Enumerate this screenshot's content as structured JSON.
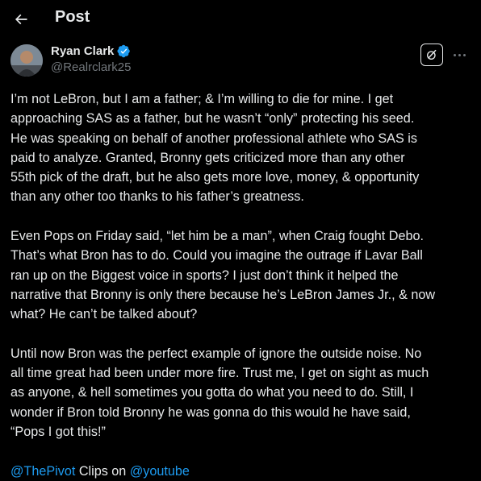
{
  "header": {
    "title": "Post"
  },
  "author": {
    "name": "Ryan Clark",
    "handle": "@Realrclark25"
  },
  "post": {
    "paragraphs": [
      "I’m not LeBron, but I am a father; & I’m willing to die for mine. I get\napproaching SAS as a father, but he wasn’t “only” protecting his seed.\nHe was speaking on behalf of another professional athlete who SAS is\npaid to analyze. Granted, Bronny gets criticized more than any other\n55th pick of the draft, but he also gets more love, money, & opportunity\nthan any other too thanks to his father’s greatness.",
      "Even Pops on Friday said, “let him be a man”, when Craig fought Debo.\nThat’s what Bron has to do. Could you imagine the outrage if Lavar Ball\nran up on the Biggest voice in sports? I just don’t think it helped the\nnarrative that Bronny is only there because he’s LeBron James Jr., & now\nwhat? He can’t be talked about?",
      "Until now Bron was the perfect example of ignore the outside noise. No\nall time great had been under more fire. Trust me, I get on sight as much\nas anyone, & hell sometimes you gotta do what you need to do. Still, I\nwonder if Bron told Bronny he was gonna do this would he have said,\n“Pops I got this!”"
    ],
    "footer": {
      "mention1": "@ThePivot",
      "text1": " Clips on ",
      "mention2": "@youtube"
    }
  },
  "icons": {
    "back": "arrow-left-icon",
    "verified": "verified-badge-icon",
    "grok": "grok-icon",
    "more": "more-horizontal-icon"
  },
  "colors": {
    "background": "#000000",
    "text": "#e7e9ea",
    "secondary": "#71767b",
    "accent": "#1d9bf0"
  }
}
